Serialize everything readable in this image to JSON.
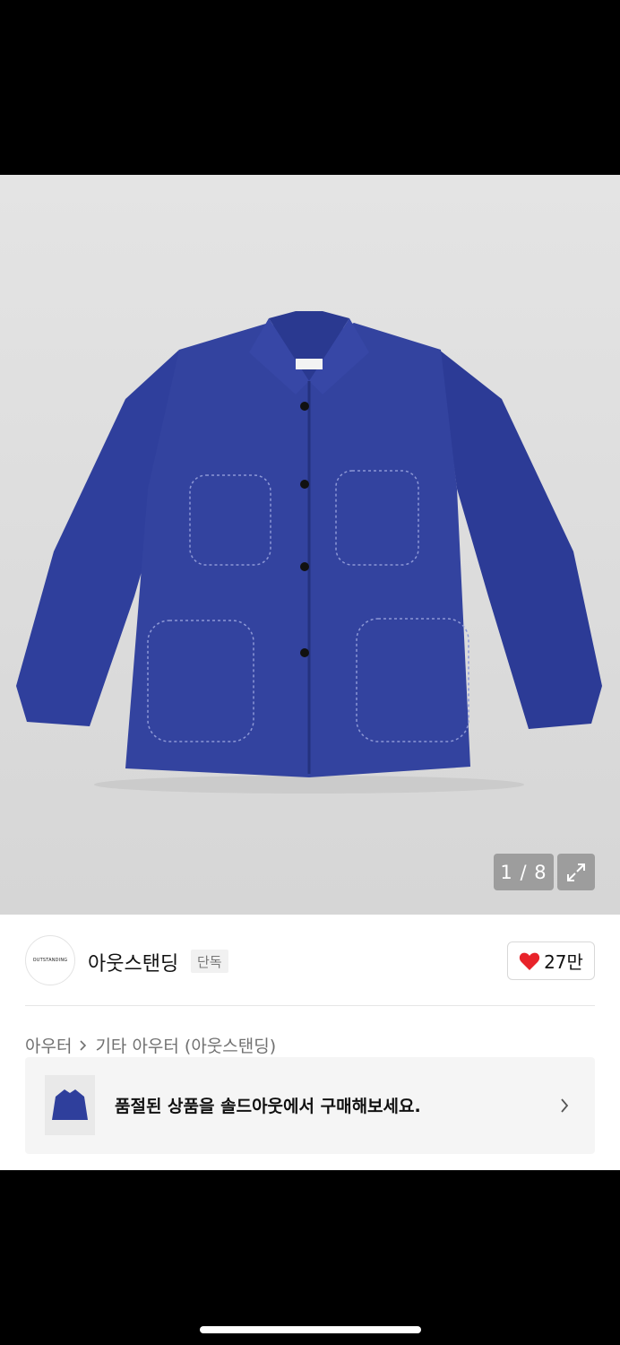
{
  "gallery": {
    "counter": "1 / 8",
    "product_image": "blue-cotton-work-jacket",
    "thumbnail_strip": "jacket-colorways-thumbnail",
    "expand_icon": "expand-icon",
    "next_icon": "chevron-right-icon"
  },
  "brand": {
    "logo_text": "OUTSTANDING",
    "name": "아웃스탠딩",
    "tag": "단독",
    "likes": "27만",
    "heart_color": "#e8232a"
  },
  "breadcrumb": {
    "category": "아우터",
    "subcategory": "기타 아우터 (아웃스탠딩)"
  },
  "resell_banner": {
    "text": "품절된 상품을 솔드아웃에서 구매해보세요."
  },
  "colors": {
    "jacket_blue": "#2f3f9c",
    "overlay_gray": "#9d9d9d"
  }
}
